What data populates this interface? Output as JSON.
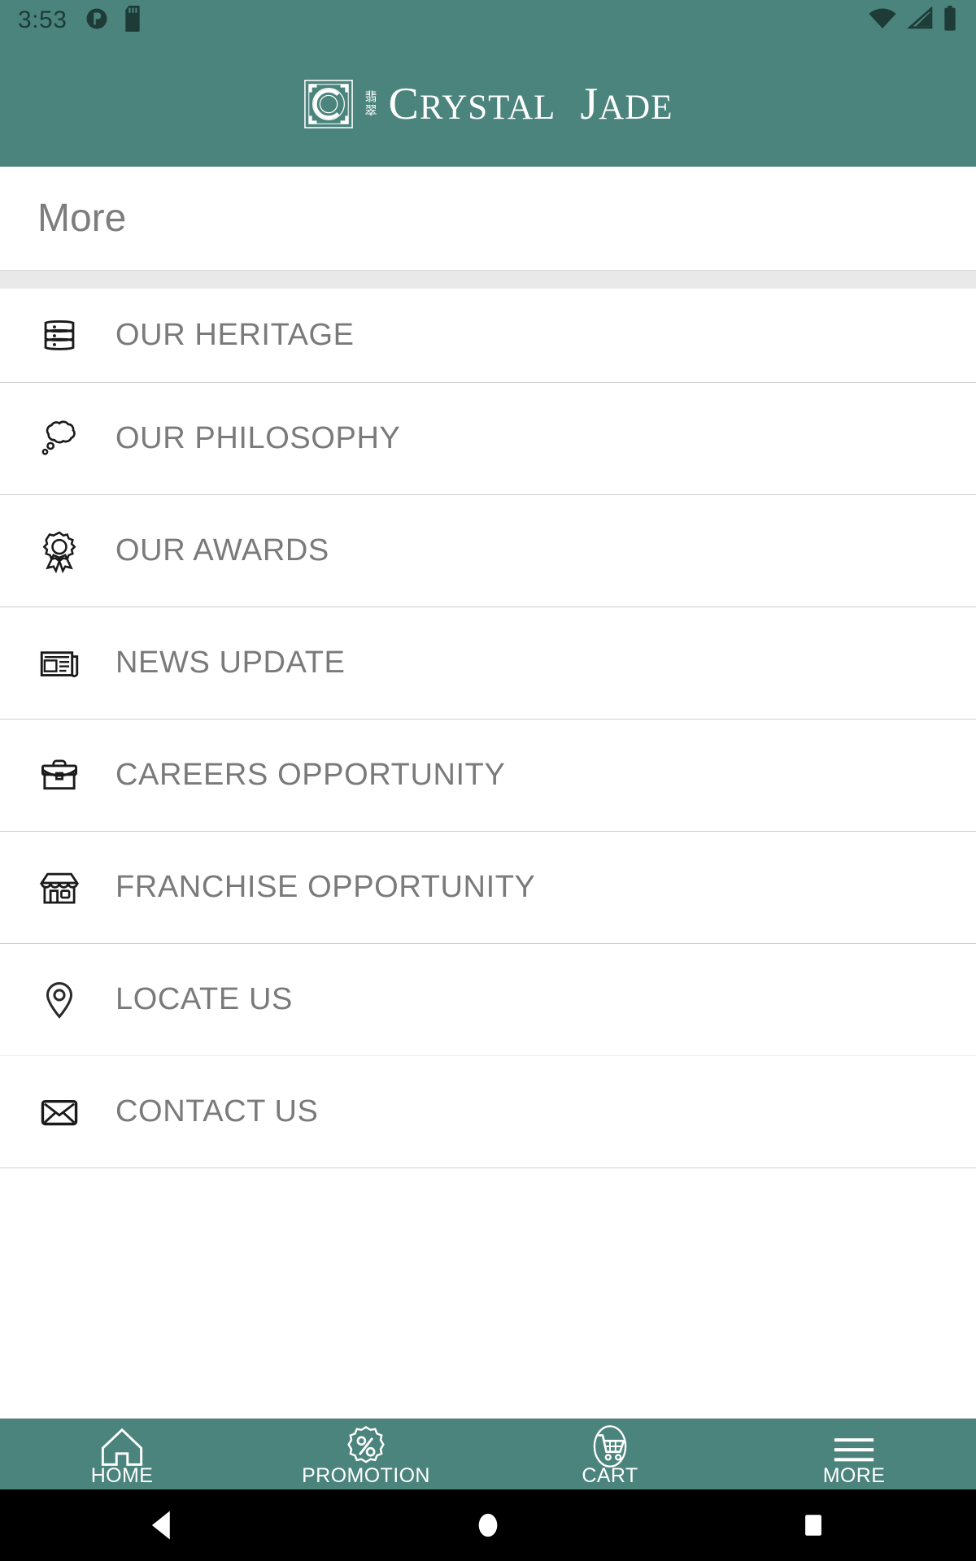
{
  "status_bar": {
    "time": "3:53",
    "left_icons": [
      "do-not-disturb-icon",
      "sd-card-icon"
    ],
    "right_icons": [
      "wifi-icon",
      "cellular-signal-icon",
      "battery-icon"
    ]
  },
  "brand": {
    "name": "CRYSTAL JADE",
    "word_1": "C",
    "word_1_rest": "RYSTAL",
    "word_2": "J",
    "word_2_rest": "ADE",
    "emblem": "crystal-jade-emblem",
    "chinese_1": "翡",
    "chinese_2": "翠",
    "bar_color": "#4a847c"
  },
  "page": {
    "title": "More"
  },
  "menu": {
    "items": [
      {
        "label": "OUR HERITAGE",
        "icon": "layers-icon"
      },
      {
        "label": "OUR PHILOSOPHY",
        "icon": "thought-bubble-icon"
      },
      {
        "label": "OUR AWARDS",
        "icon": "award-ribbon-icon"
      },
      {
        "label": "NEWS UPDATE",
        "icon": "newspaper-icon"
      },
      {
        "label": "CAREERS OPPORTUNITY",
        "icon": "briefcase-icon"
      },
      {
        "label": "FRANCHISE OPPORTUNITY",
        "icon": "storefront-icon"
      },
      {
        "label": "LOCATE US",
        "icon": "map-pin-icon"
      },
      {
        "label": "CONTACT US",
        "icon": "envelope-icon"
      }
    ]
  },
  "bottom_nav": {
    "items": [
      {
        "label": "HOME",
        "icon": "home-icon"
      },
      {
        "label": "PROMOTION",
        "icon": "percent-badge-icon"
      },
      {
        "label": "CART",
        "icon": "shopping-cart-icon"
      },
      {
        "label": "MORE",
        "icon": "hamburger-menu-icon"
      }
    ],
    "active": "MORE",
    "bar_color": "#4a847c"
  },
  "system_nav": {
    "back": "back-triangle-icon",
    "home": "home-circle-icon",
    "recents": "recents-square-icon"
  },
  "colors": {
    "brand_teal": "#4a847c",
    "text_gray": "#7a7a7a",
    "divider": "#cfcfcf",
    "scroll_band": "#e9e9e9"
  }
}
